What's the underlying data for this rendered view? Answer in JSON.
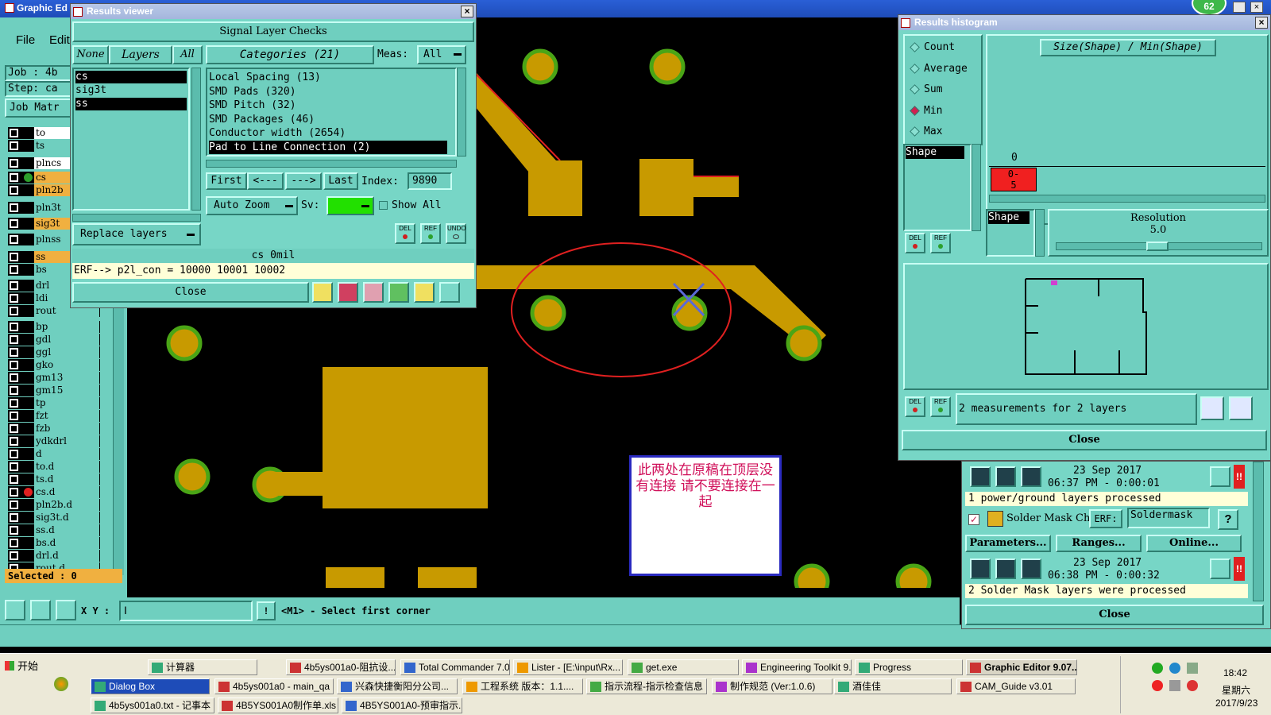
{
  "main_window": {
    "title": "Graphic Ed",
    "menu": [
      "File",
      "Edit"
    ],
    "job_label": "Job : 4b",
    "step_label": "Step: ca",
    "job_matrix": "Job Matr",
    "selected": "Selected : 0",
    "xy_label": "X Y :",
    "xy_value": "I",
    "status_msg": "<M1> - Select first corner"
  },
  "layers": [
    {
      "name": "to",
      "color": "#6fcfbf",
      "name_bg": "#ffffff",
      "dot": ""
    },
    {
      "name": "ts",
      "color": "#6fcfbf",
      "name_bg": "#6fcfbf",
      "dot": ""
    },
    {
      "name": "plncs",
      "color": "#6fcfbf",
      "name_bg": "#ffffff",
      "dot": ""
    },
    {
      "name": "cs",
      "color": "#c89a00",
      "name_bg": "#f0b040",
      "dot": "#2ca02c"
    },
    {
      "name": "pln2b",
      "color": "#c89a00",
      "name_bg": "#f0b040",
      "dot": ""
    },
    {
      "name": "pln3t",
      "color": "#6fcfbf",
      "name_bg": "#6fcfbf",
      "dot": ""
    },
    {
      "name": "sig3t",
      "color": "#c89a00",
      "name_bg": "#f0b040",
      "dot": ""
    },
    {
      "name": "plnss",
      "color": "#6fcfbf",
      "name_bg": "#6fcfbf",
      "dot": ""
    },
    {
      "name": "ss",
      "color": "#c89a00",
      "name_bg": "#f0b040",
      "dot": ""
    },
    {
      "name": "bs",
      "color": "#6fcfbf",
      "name_bg": "#6fcfbf",
      "dot": ""
    },
    {
      "name": "drl",
      "color": "#6fcfbf",
      "name_bg": "#6fcfbf",
      "dot": ""
    },
    {
      "name": "ldi",
      "color": "#6fcfbf",
      "name_bg": "#6fcfbf",
      "dot": ""
    },
    {
      "name": "rout",
      "color": "#6fcfbf",
      "name_bg": "#6fcfbf",
      "dot": ""
    },
    {
      "name": "bp",
      "color": "#6fcfbf",
      "name_bg": "#6fcfbf",
      "dot": ""
    },
    {
      "name": "gdl",
      "color": "#6fcfbf",
      "name_bg": "#6fcfbf",
      "dot": ""
    },
    {
      "name": "ggl",
      "color": "#6fcfbf",
      "name_bg": "#6fcfbf",
      "dot": ""
    },
    {
      "name": "gko",
      "color": "#6fcfbf",
      "name_bg": "#6fcfbf",
      "dot": ""
    },
    {
      "name": "gm13",
      "color": "#6fcfbf",
      "name_bg": "#6fcfbf",
      "dot": ""
    },
    {
      "name": "gm15",
      "color": "#6fcfbf",
      "name_bg": "#6fcfbf",
      "dot": ""
    },
    {
      "name": "tp",
      "color": "#6fcfbf",
      "name_bg": "#6fcfbf",
      "dot": ""
    },
    {
      "name": "fzt",
      "color": "#6fcfbf",
      "name_bg": "#6fcfbf",
      "dot": ""
    },
    {
      "name": "fzb",
      "color": "#6fcfbf",
      "name_bg": "#6fcfbf",
      "dot": ""
    },
    {
      "name": "ydkdrl",
      "color": "#6fcfbf",
      "name_bg": "#6fcfbf",
      "dot": ""
    },
    {
      "name": "d",
      "color": "#6fcfbf",
      "name_bg": "#6fcfbf",
      "dot": ""
    },
    {
      "name": "to.d",
      "color": "#6fcfbf",
      "name_bg": "#6fcfbf",
      "dot": ""
    },
    {
      "name": "ts.d",
      "color": "#6fcfbf",
      "name_bg": "#6fcfbf",
      "dot": ""
    },
    {
      "name": "cs.d",
      "color": "#6fcfbf",
      "name_bg": "#6fcfbf",
      "dot": "#e02020"
    },
    {
      "name": "pln2b.d",
      "color": "#6fcfbf",
      "name_bg": "#6fcfbf",
      "dot": ""
    },
    {
      "name": "sig3t.d",
      "color": "#6fcfbf",
      "name_bg": "#6fcfbf",
      "dot": ""
    },
    {
      "name": "ss.d",
      "color": "#6fcfbf",
      "name_bg": "#6fcfbf",
      "dot": ""
    },
    {
      "name": "bs.d",
      "color": "#6fcfbf",
      "name_bg": "#6fcfbf",
      "dot": ""
    },
    {
      "name": "drl.d",
      "color": "#6fcfbf",
      "name_bg": "#6fcfbf",
      "dot": ""
    },
    {
      "name": "rout.d",
      "color": "#6fcfbf",
      "name_bg": "#6fcfbf",
      "dot": ""
    }
  ],
  "results_viewer": {
    "title": "Results viewer",
    "header": "Signal Layer Checks",
    "tab_none": "None",
    "tab_layers": "Layers",
    "tab_all": "All",
    "layer_list": [
      "cs",
      "sig3t",
      "ss"
    ],
    "categories_label": "Categories (21)",
    "meas_label": "Meas:",
    "meas_value": "All",
    "categories": [
      "Local Spacing (13)",
      "SMD Pads (320)",
      "SMD Pitch (32)",
      "SMD Packages (46)",
      "Conductor width (2654)",
      "Pad to Line Connection (2)"
    ],
    "btn_first": "First",
    "btn_prev": "<---",
    "btn_next": "--->",
    "btn_last": "Last",
    "index_label": "Index:",
    "index_value": "9890",
    "auto_zoom": "Auto Zoom",
    "sv_label": "Sv:",
    "show_all": "Show All",
    "replace_layers": "Replace layers",
    "del": "DEL",
    "ref": "REF",
    "undo": "UNDO",
    "status_layer": "cs 0mil",
    "erf_line": "ERF--> p2l_con = 10000 10001 10002",
    "close": "Close"
  },
  "histogram": {
    "title": "Results histogram",
    "modes": [
      "Count",
      "Average",
      "Sum",
      "Min",
      "Max"
    ],
    "selected_mode": "Min",
    "formula": "Size(Shape) / Min(Shape)",
    "shape_label": "Shape",
    "axis_zero": "0",
    "bin_label": "0-\n5",
    "shape_label2": "Shape",
    "resolution_label": "Resolution",
    "resolution_value": "5.0",
    "del": "DEL",
    "ref": "REF",
    "measurements_text": "2 measurements for 2 layers",
    "close": "Close"
  },
  "progress_panel": {
    "run1_date": "23 Sep 2017",
    "run1_time": "06:37 PM - 0:00:01",
    "run1_msg": "1 power/ground layers processed",
    "solder_mask_label": "Solder Mask Ch",
    "erf_label": "ERF:",
    "erf_value": "Soldermask",
    "help": "?",
    "btn_parameters": "Parameters...",
    "btn_ranges": "Ranges...",
    "btn_online": "Online...",
    "run2_date": "23 Sep 2017",
    "run2_time": "06:38 PM - 0:00:32",
    "run2_msg": "2 Solder Mask layers were processed",
    "close": "Close"
  },
  "annotation_note": "此两处在原稿在顶层没有连接 请不要连接在一起",
  "badge": "62",
  "taskbar": {
    "start": "开始",
    "row1": [
      "计算器",
      "4b5ys001a0-阻抗设...",
      "Total Commander 7.0...",
      "Lister - [E:\\input\\Rx...",
      "get.exe",
      "Engineering Toolkit 9....",
      "Progress",
      "Graphic Editor 9.07..."
    ],
    "row2": [
      "Dialog Box",
      "4b5ys001a0 - main_qa",
      "兴森快捷衡阳分公司...",
      "工程系统  版本：1.1....",
      "指示流程-指示检查信息",
      "制作规范 (Ver:1.0.6)",
      "酒佳佳",
      "CAM_Guide v3.01"
    ],
    "row3": [
      "4b5ys001a0.txt - 记事本",
      "4B5YS001A0制作单.xls ...",
      "4B5YS001A0-预审指示...."
    ],
    "time": "18:42",
    "weekday": "星期六",
    "date": "2017/9/23"
  }
}
